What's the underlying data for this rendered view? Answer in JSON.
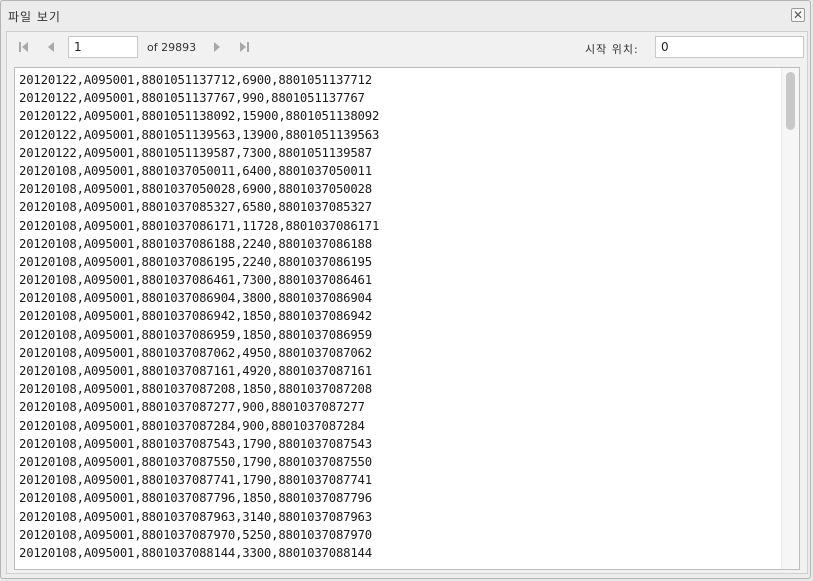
{
  "window": {
    "title": "파일 보기",
    "close_icon": "close-icon"
  },
  "toolbar": {
    "first_page_icon": "first-page-icon",
    "prev_page_icon": "prev-page-icon",
    "next_page_icon": "next-page-icon",
    "last_page_icon": "last-page-icon",
    "current_page": "1",
    "of_label": "of 29893",
    "start_position_label": "시작 위치:",
    "start_position_value": "0"
  },
  "content": {
    "lines": [
      "20120122,A095001,8801051137712,6900,8801051137712",
      "20120122,A095001,8801051137767,990,8801051137767",
      "20120122,A095001,8801051138092,15900,8801051138092",
      "20120122,A095001,8801051139563,13900,8801051139563",
      "20120122,A095001,8801051139587,7300,8801051139587",
      "20120108,A095001,8801037050011,6400,8801037050011",
      "20120108,A095001,8801037050028,6900,8801037050028",
      "20120108,A095001,8801037085327,6580,8801037085327",
      "20120108,A095001,8801037086171,11728,8801037086171",
      "20120108,A095001,8801037086188,2240,8801037086188",
      "20120108,A095001,8801037086195,2240,8801037086195",
      "20120108,A095001,8801037086461,7300,8801037086461",
      "20120108,A095001,8801037086904,3800,8801037086904",
      "20120108,A095001,8801037086942,1850,8801037086942",
      "20120108,A095001,8801037086959,1850,8801037086959",
      "20120108,A095001,8801037087062,4950,8801037087062",
      "20120108,A095001,8801037087161,4920,8801037087161",
      "20120108,A095001,8801037087208,1850,8801037087208",
      "20120108,A095001,8801037087277,900,8801037087277",
      "20120108,A095001,8801037087284,900,8801037087284",
      "20120108,A095001,8801037087543,1790,8801037087543",
      "20120108,A095001,8801037087550,1790,8801037087550",
      "20120108,A095001,8801037087741,1790,8801037087741",
      "20120108,A095001,8801037087796,1850,8801037087796",
      "20120108,A095001,8801037087963,3140,8801037087963",
      "20120108,A095001,8801037087970,5250,8801037087970",
      "20120108,A095001,8801037088144,3300,8801037088144"
    ]
  }
}
